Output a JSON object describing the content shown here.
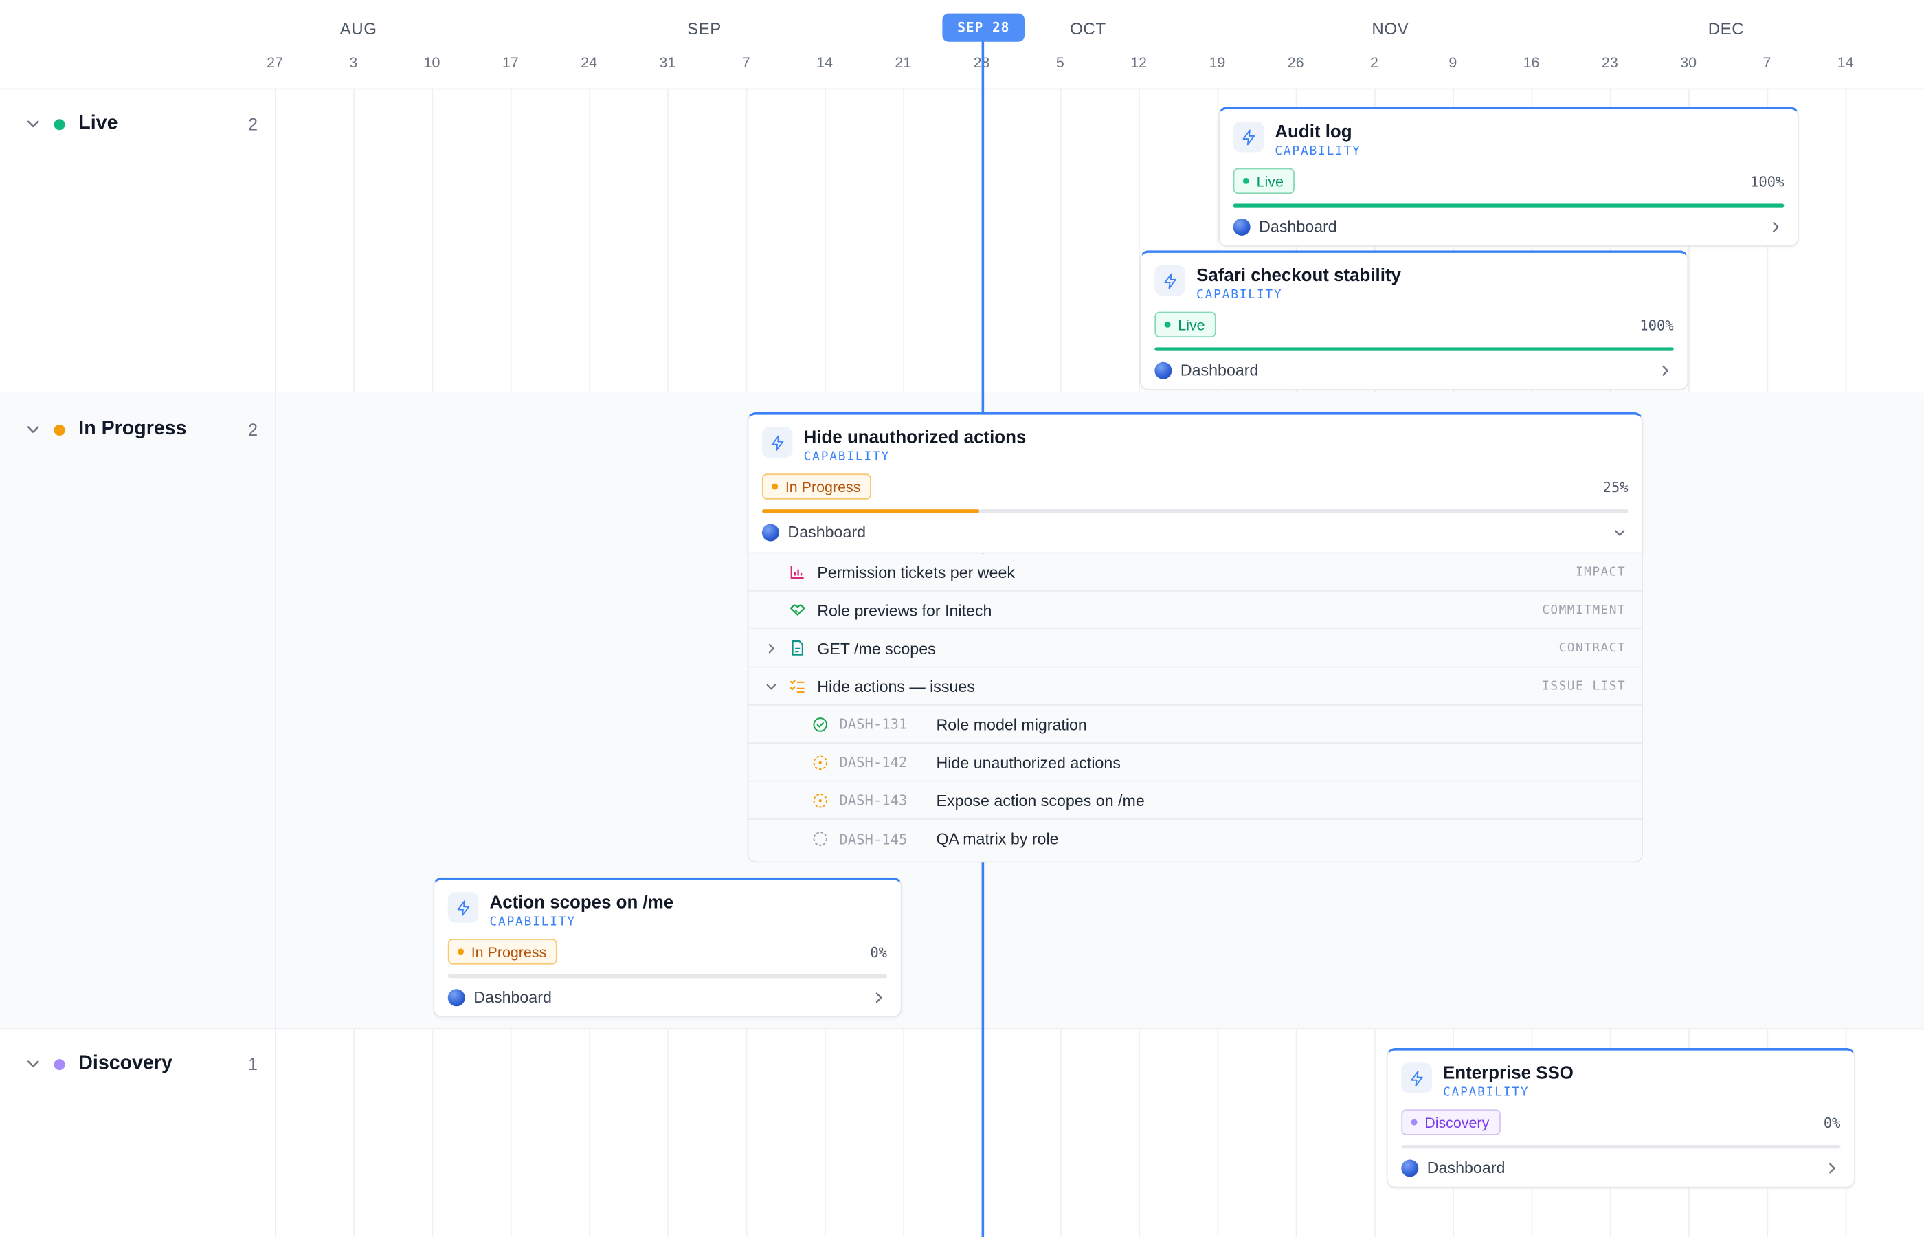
{
  "timeline": {
    "months": [
      "AUG",
      "SEP",
      "OCT",
      "NOV",
      "DEC"
    ],
    "days": [
      "27",
      "3",
      "10",
      "17",
      "24",
      "31",
      "7",
      "14",
      "21",
      "28",
      "5",
      "12",
      "19",
      "26",
      "2",
      "9",
      "16",
      "23",
      "30",
      "7",
      "14"
    ],
    "today_label": "SEP 28"
  },
  "lanes": [
    {
      "id": "live",
      "title": "Live",
      "count": "2",
      "color": "#10b981"
    },
    {
      "id": "in_progress",
      "title": "In Progress",
      "count": "2",
      "color": "#f59e0b"
    },
    {
      "id": "discovery",
      "title": "Discovery",
      "count": "1",
      "color": "#a78bfa"
    }
  ],
  "cards": {
    "audit_log": {
      "title": "Audit log",
      "type": "CAPABILITY",
      "status": "Live",
      "percent_label": "100%",
      "progress": 1.0,
      "project": "Dashboard"
    },
    "safari_checkout": {
      "title": "Safari checkout stability",
      "type": "CAPABILITY",
      "status": "Live",
      "percent_label": "100%",
      "progress": 1.0,
      "project": "Dashboard"
    },
    "hide_unauthorized": {
      "title": "Hide unauthorized actions",
      "type": "CAPABILITY",
      "status": "In Progress",
      "percent_label": "25%",
      "progress": 0.25,
      "project": "Dashboard",
      "links": [
        {
          "label": "Permission tickets per week",
          "tag": "IMPACT",
          "icon": "bar-chart-icon"
        },
        {
          "label": "Role previews for Initech",
          "tag": "COMMITMENT",
          "icon": "handshake-icon"
        },
        {
          "label": "GET /me scopes",
          "tag": "CONTRACT",
          "icon": "document-icon"
        },
        {
          "label": "Hide actions — issues",
          "tag": "ISSUE LIST",
          "icon": "checklist-icon"
        }
      ],
      "issues": [
        {
          "key": "DASH-131",
          "title": "Role model migration",
          "state": "done"
        },
        {
          "key": "DASH-142",
          "title": "Hide unauthorized actions",
          "state": "in-progress"
        },
        {
          "key": "DASH-143",
          "title": "Expose action scopes on /me",
          "state": "in-progress"
        },
        {
          "key": "DASH-145",
          "title": "QA matrix by role",
          "state": "todo"
        }
      ]
    },
    "action_scopes": {
      "title": "Action scopes on /me",
      "type": "CAPABILITY",
      "status": "In Progress",
      "percent_label": "0%",
      "progress": 0.0,
      "project": "Dashboard"
    },
    "enterprise_sso": {
      "title": "Enterprise SSO",
      "type": "CAPABILITY",
      "status": "Discovery",
      "percent_label": "0%",
      "progress": 0.0,
      "project": "Dashboard"
    }
  },
  "colors": {
    "accent": "#3b82f6",
    "live": "#10b981",
    "in_progress": "#f59e0b",
    "discovery": "#a78bfa"
  }
}
